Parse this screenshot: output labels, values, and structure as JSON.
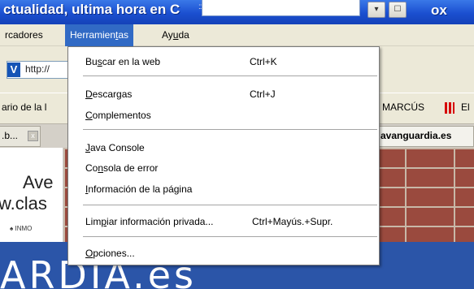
{
  "window": {
    "title_left": "ctualidad, ultima hora en C",
    "title_right": "ox",
    "grip": ":::",
    "buttons": [
      "▾",
      "☐"
    ]
  },
  "menubar": {
    "items": [
      {
        "pre": "rcadores",
        "acc": "",
        "post": ""
      },
      {
        "pre": "Herramien",
        "acc": "t",
        "post": "as"
      },
      {
        "pre": "Ay",
        "acc": "u",
        "post": "da"
      }
    ]
  },
  "navbar": {
    "url": "http://",
    "favicon": "V"
  },
  "bookmarks": {
    "left": "ario de la l",
    "right": "MARCÚS",
    "right_partial": "El"
  },
  "tabs": {
    "left_label": ".b...",
    "close": "x",
    "right_label": "avanguardia.es"
  },
  "page": {
    "ad_line1": "Ave",
    "ad_line2": "w.clas",
    "ad_small": "♠ INMO",
    "brand": "ARDIA.es"
  },
  "dropdown": {
    "items": [
      {
        "pre": "Bu",
        "acc": "s",
        "post": "car en la web",
        "shortcut": "Ctrl+K"
      },
      {
        "pre": "",
        "acc": "D",
        "post": "escargas",
        "shortcut": "Ctrl+J"
      },
      {
        "pre": "",
        "acc": "C",
        "post": "omplementos",
        "shortcut": ""
      },
      {
        "pre": "",
        "acc": "J",
        "post": "ava Console",
        "shortcut": ""
      },
      {
        "pre": "Co",
        "acc": "n",
        "post": "sola de error",
        "shortcut": ""
      },
      {
        "pre": "",
        "acc": "I",
        "post": "nformación de la página",
        "shortcut": ""
      },
      {
        "pre": "Lim",
        "acc": "p",
        "post": "iar información privada...",
        "shortcut": "Ctrl+Mayús.+Supr."
      },
      {
        "pre": "",
        "acc": "O",
        "post": "pciones...",
        "shortcut": ""
      }
    ]
  }
}
